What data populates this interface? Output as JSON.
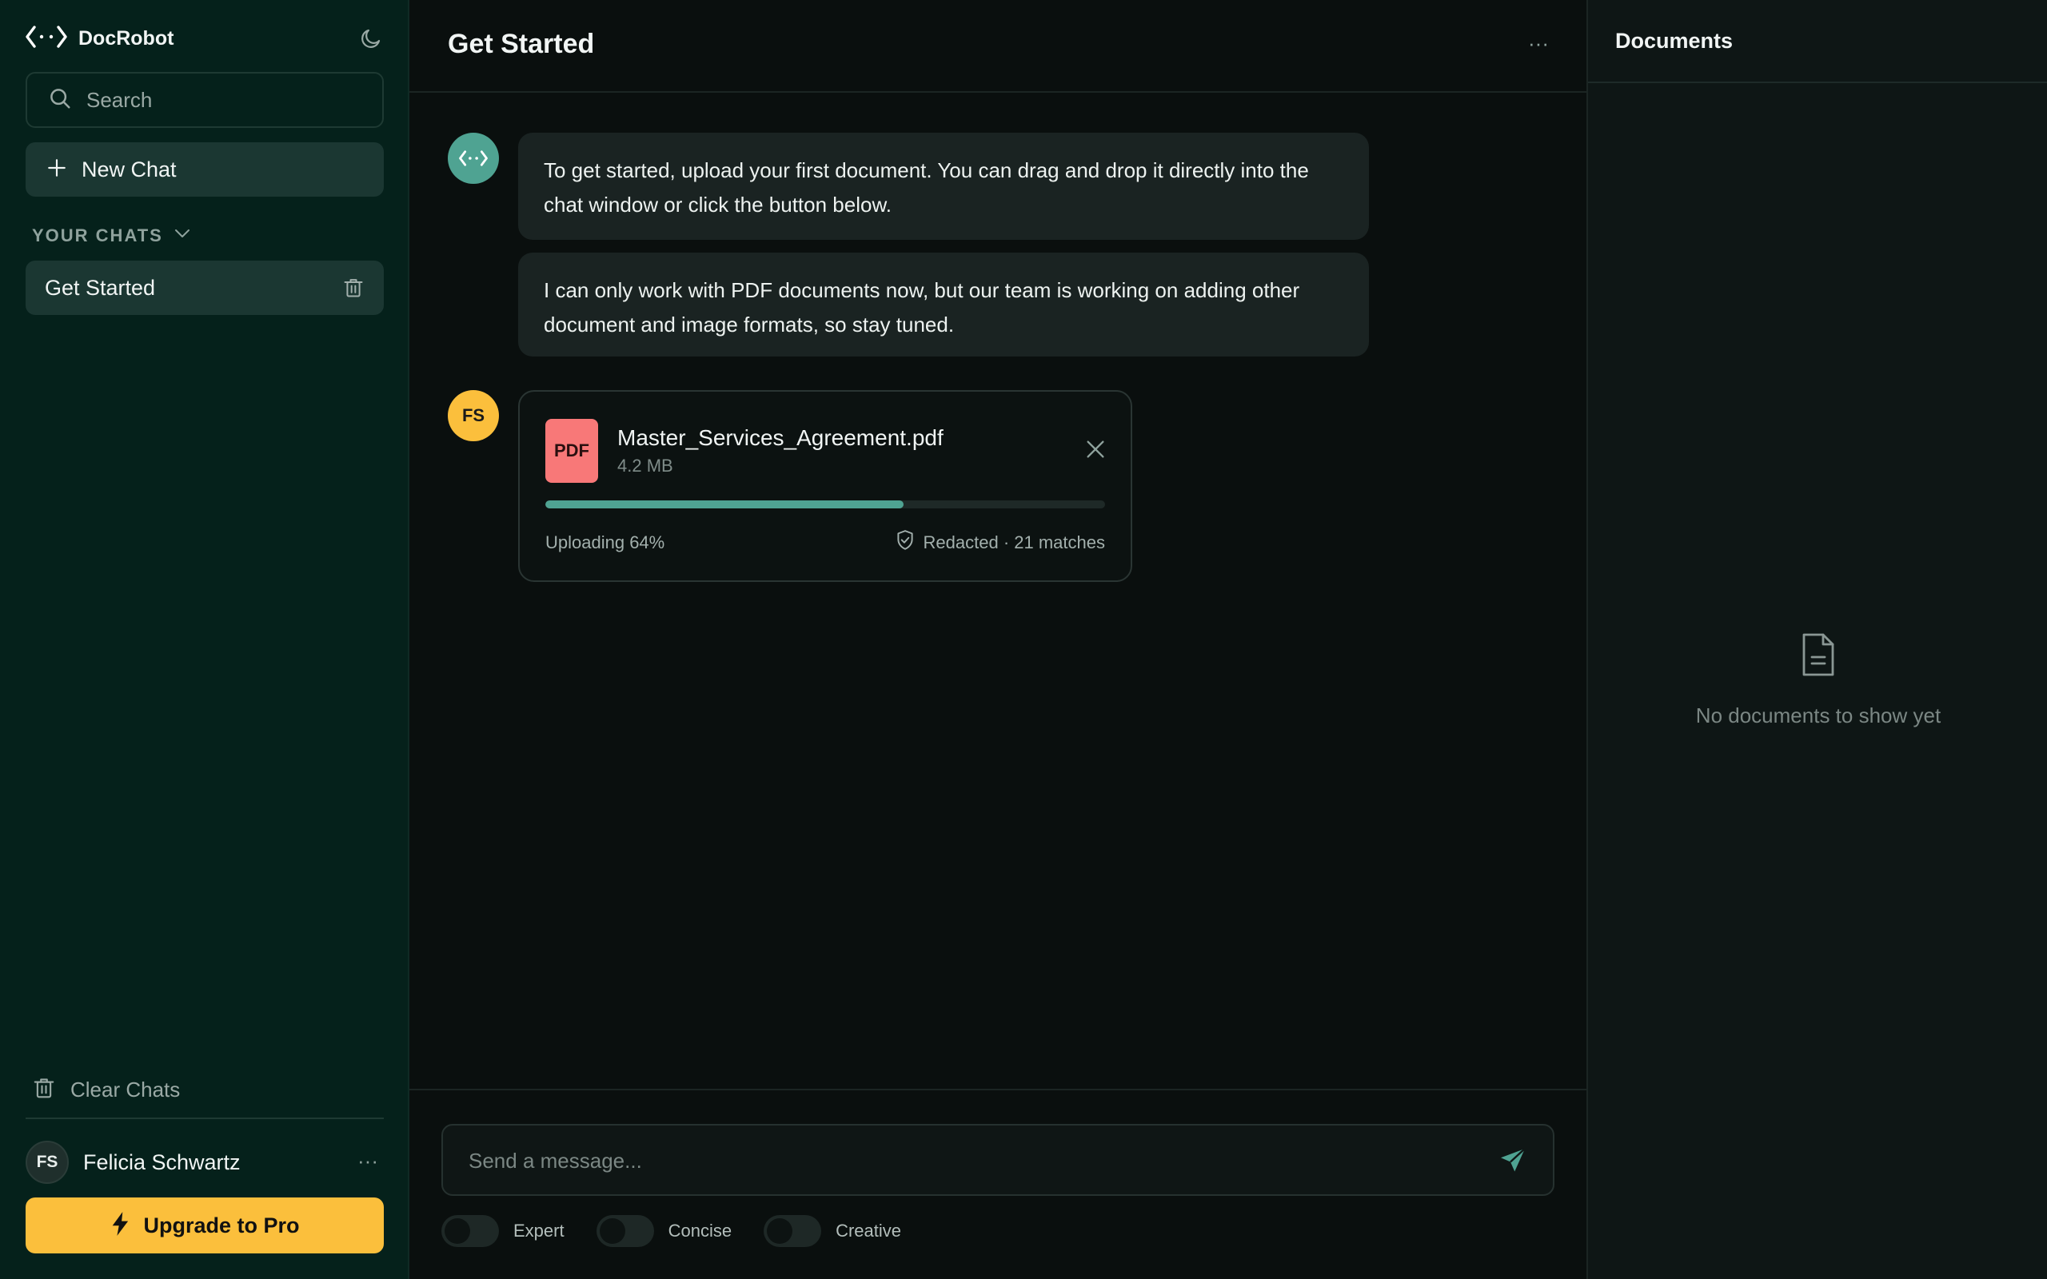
{
  "app": {
    "name": "DocRobot"
  },
  "sidebar": {
    "search_placeholder": "Search",
    "new_chat_label": "New Chat",
    "section_label": "YOUR CHATS",
    "chats": [
      {
        "label": "Get Started"
      }
    ],
    "clear_label": "Clear Chats",
    "user": {
      "initials": "FS",
      "name": "Felicia Schwartz"
    },
    "upgrade_label": "Upgrade to Pro"
  },
  "main": {
    "title": "Get Started",
    "bot_messages": [
      "To get started, upload your first document. You can drag and drop it directly into the chat window or click the button below.",
      "I can only work with PDF documents now, but our team is working on adding other document and image formats, so stay tuned."
    ],
    "user_initials": "FS",
    "upload": {
      "badge": "PDF",
      "file_name": "Master_Services_Agreement.pdf",
      "file_size": "4.2 MB",
      "progress_percent": 64,
      "status": "Uploading 64%",
      "redaction": "Redacted · 21 matches"
    },
    "composer_placeholder": "Send a message...",
    "toggles": [
      {
        "label": "Expert",
        "on": false
      },
      {
        "label": "Concise",
        "on": false
      },
      {
        "label": "Creative",
        "on": false
      }
    ]
  },
  "documents": {
    "title": "Documents",
    "empty_text": "No documents to show yet"
  },
  "colors": {
    "accent": "#4fa392",
    "upgrade": "#fbbf3c",
    "pdf_badge": "#f87878",
    "sidebar_bg": "#05211b"
  }
}
